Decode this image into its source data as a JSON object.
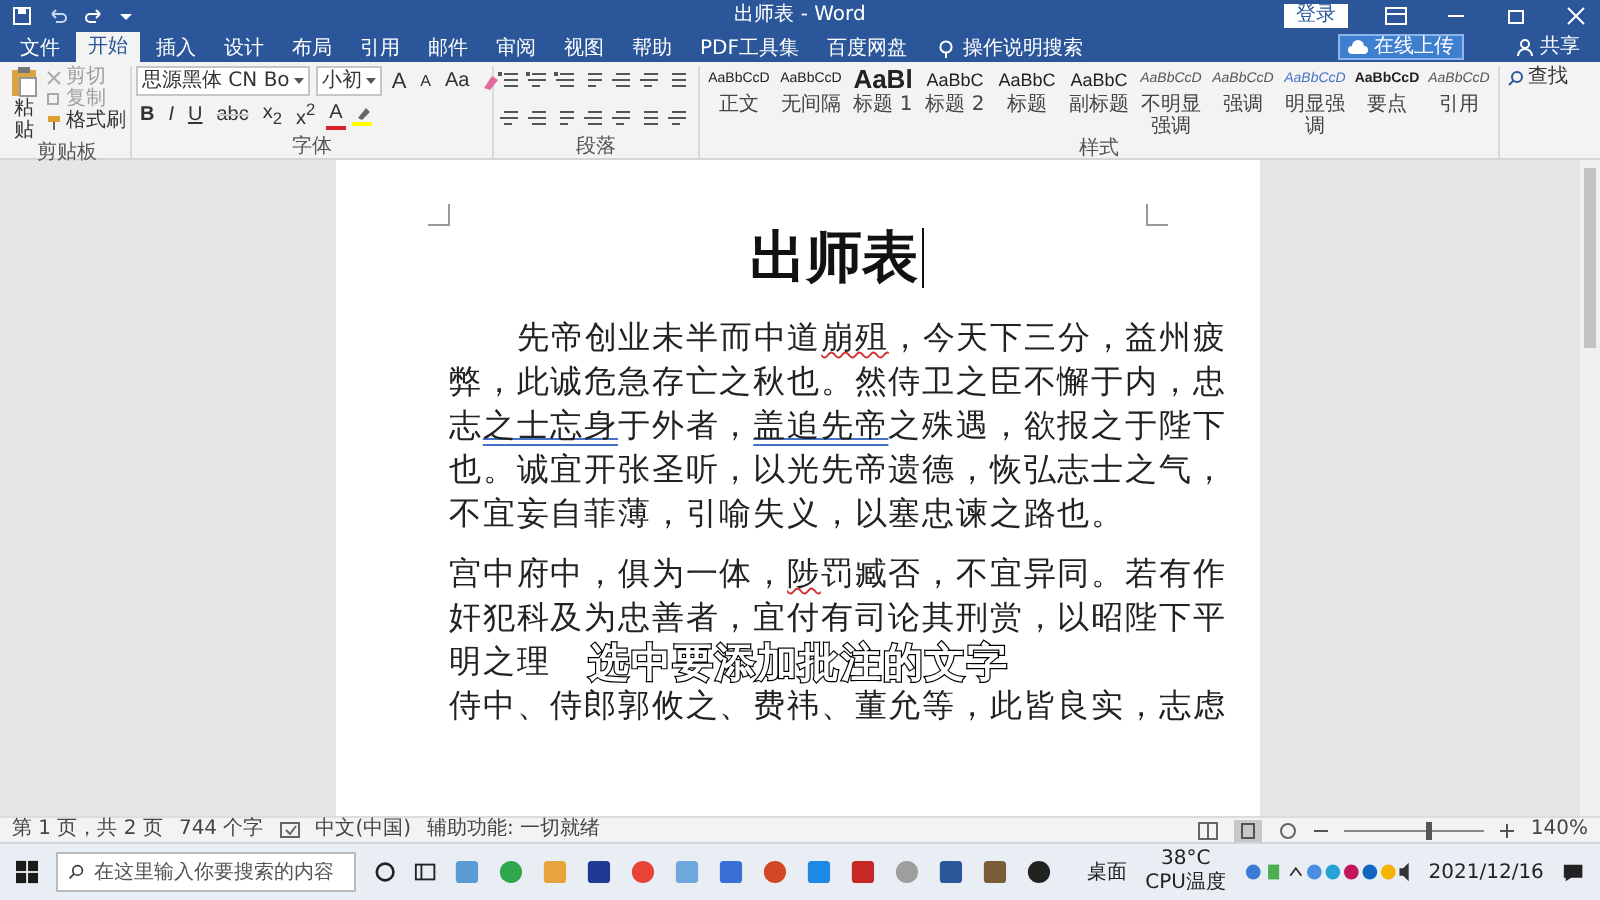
{
  "title_bar": {
    "title": "出师表 - Word",
    "login": "登录"
  },
  "ribbon_tabs": [
    {
      "label": "文件",
      "selected": false
    },
    {
      "label": "开始",
      "selected": true
    },
    {
      "label": "插入",
      "selected": false
    },
    {
      "label": "设计",
      "selected": false
    },
    {
      "label": "布局",
      "selected": false
    },
    {
      "label": "引用",
      "selected": false
    },
    {
      "label": "邮件",
      "selected": false
    },
    {
      "label": "审阅",
      "selected": false
    },
    {
      "label": "视图",
      "selected": false
    },
    {
      "label": "帮助",
      "selected": false
    },
    {
      "label": "PDF工具集",
      "selected": false
    },
    {
      "label": "百度网盘",
      "selected": false
    }
  ],
  "tell_me": "操作说明搜索",
  "upload_button": "在线上传",
  "share": "共享",
  "clipboard": {
    "paste": "粘贴",
    "cut": "剪切",
    "copy": "复制",
    "format_painter": "格式刷",
    "label": "剪贴板"
  },
  "font": {
    "name": "思源黑体 CN Bo",
    "size": "小初",
    "label": "字体",
    "row_1": [
      {
        "label": "A",
        "kind": "grow"
      },
      {
        "label": "A",
        "kind": "shrink"
      },
      {
        "label": "Aa",
        "kind": "case"
      }
    ],
    "row_2": [
      {
        "label": "B",
        "kind": "bold"
      },
      {
        "label": "I",
        "kind": "italic"
      },
      {
        "label": "U",
        "kind": "underline"
      },
      {
        "label": "abc",
        "kind": "strike"
      },
      {
        "label": "x$_{2}$",
        "kind": "sub"
      },
      {
        "label": "x$^{2}$",
        "kind": "sup"
      },
      {
        "label": "A",
        "kind": "color"
      }
    ]
  },
  "paragraph": {
    "label": "段落"
  },
  "styles": {
    "label": "样式",
    "items": [
      {
        "preview": "AaBbCcD",
        "name": "正文",
        "kind": "body"
      },
      {
        "preview": "AaBbCcD",
        "name": "无间隔",
        "kind": "body"
      },
      {
        "preview": "AaBl",
        "name": "标题 1",
        "kind": "heading"
      },
      {
        "preview": "AaBbC",
        "name": "标题 2",
        "kind": "subheading"
      },
      {
        "preview": "AaBbC",
        "name": "标题",
        "kind": "subheading"
      },
      {
        "preview": "AaBbC",
        "name": "副标题",
        "kind": "subheading"
      },
      {
        "preview": "AaBbCcD",
        "name": "不明显强调",
        "kind": "emphasis"
      },
      {
        "preview": "AaBbCcD",
        "name": "强调",
        "kind": "emphasis"
      },
      {
        "preview": "AaBbCcD",
        "name": "明显强调",
        "kind": "intense"
      },
      {
        "preview": "AaBbCcD",
        "name": "要点",
        "kind": "strong"
      },
      {
        "preview": "AaBbCcD",
        "name": "引用",
        "kind": "emphasis"
      }
    ]
  },
  "editing": {
    "find": "查找"
  },
  "document": {
    "title": "出师表",
    "paragraphs": [
      {
        "indent": true,
        "lines": [
          [
            {
              "text": "先帝创业未半而中道",
              "kind": "plain"
            },
            {
              "text": "崩殂",
              "kind": "spelling"
            },
            {
              "text": "，今天下三分，益州疲",
              "kind": "plain"
            }
          ],
          [
            {
              "text": "弊，此诚危急存亡之秋也。然侍卫之臣不懈于内，忠",
              "kind": "plain"
            }
          ],
          [
            {
              "text": "志",
              "kind": "plain"
            },
            {
              "text": "之士忘身",
              "kind": "grammar"
            },
            {
              "text": "于外者，",
              "kind": "plain"
            },
            {
              "text": "盖追先帝",
              "kind": "grammar"
            },
            {
              "text": "之殊遇，欲报之于陛下",
              "kind": "plain"
            }
          ],
          [
            {
              "text": "也。诚宜开张圣听，以光先帝遗德，恢弘志士之气，",
              "kind": "plain"
            }
          ],
          [
            {
              "text": "不宜妄自菲薄，引喻失义，以塞忠谏之路也。",
              "kind": "plain"
            }
          ]
        ]
      },
      {
        "indent": false,
        "lines": [
          [
            {
              "text": "宫中府中，俱为一体，",
              "kind": "plain"
            },
            {
              "text": "陟",
              "kind": "spelling"
            },
            {
              "text": "罚臧否，不宜异同。若有作",
              "kind": "plain"
            }
          ],
          [
            {
              "text": "奸犯科及为忠善者，宜付有司论其刑赏，以昭陛下平",
              "kind": "plain"
            }
          ],
          [
            {
              "text": "明之理",
              "kind": "plain"
            }
          ],
          [
            {
              "text": "侍中、侍郎郭攸之、费祎、董允等，此皆良实，志虑",
              "kind": "plain"
            }
          ]
        ]
      }
    ]
  },
  "subtitle": "选中要添加批注的文字",
  "status_bar": {
    "page": "第 1 页，共 2 页",
    "words": "744 个字",
    "language": "中文(中国)",
    "accessibility": "辅助功能: 一切就绪",
    "zoom": "140%",
    "level": 0.6
  },
  "taskbar": {
    "search_placeholder": "在这里输入你要搜索的内容",
    "desktop": "桌面",
    "cpu_temp": "38°C",
    "cpu_label": "CPU温度",
    "date": "2021/12/16"
  }
}
